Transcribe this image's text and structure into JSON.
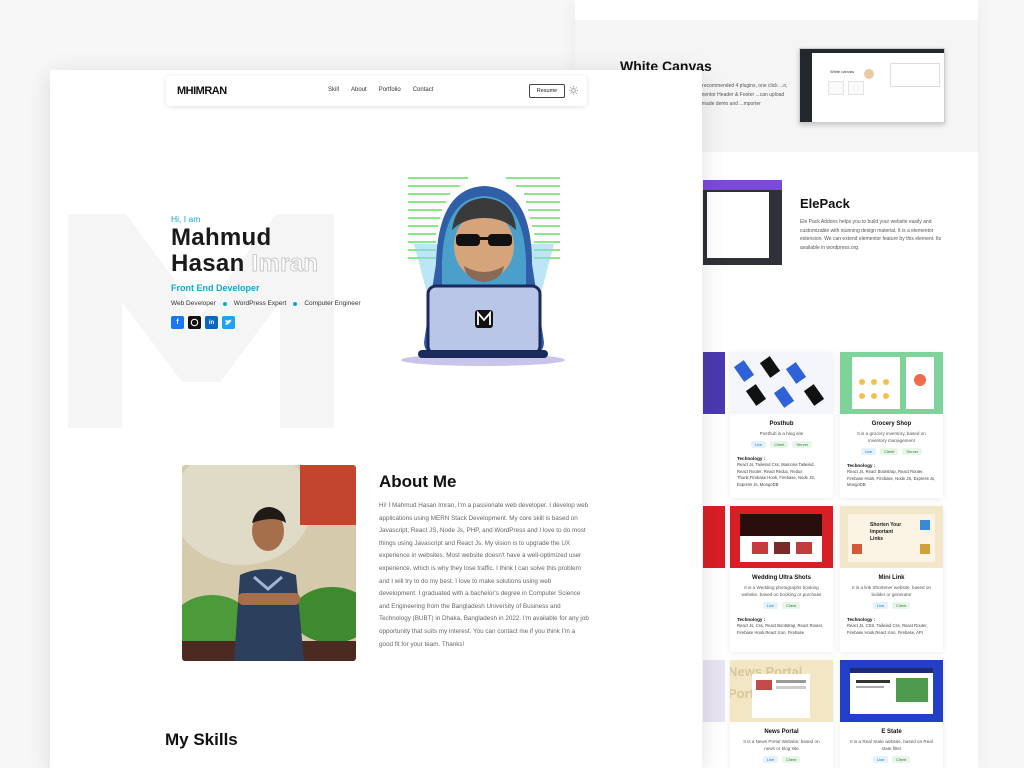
{
  "nav": {
    "logo": "MHIMRAN",
    "links": [
      "Skill",
      "About",
      "Portfolio",
      "Contact"
    ],
    "resume_label": "Resume"
  },
  "hero": {
    "greeting": "Hi, I am",
    "name_line1": "Mahmud",
    "name_line2_a": "Hasan",
    "name_line2_b": "Imran",
    "role": "Front End Developer",
    "tags": [
      "Web Developer",
      "WordPress Expert",
      "Computer Engineer"
    ],
    "socials": [
      {
        "label": "f",
        "color": "#1877f2",
        "icon": "facebook-icon"
      },
      {
        "label": "",
        "color": "#111111",
        "icon": "github-icon"
      },
      {
        "label": "in",
        "color": "#0a66c2",
        "icon": "linkedin-icon"
      },
      {
        "label": "",
        "color": "#1da1f2",
        "icon": "twitter-icon"
      }
    ]
  },
  "about": {
    "title": "About Me",
    "text": "Hi! I Mahmud Hasan Imran, I'm a passionate web developer. I develop web applications using MERN Stack Development. My core skill is based on Javascript, React JS, Node Js, PHP, and WordPress and I love to do most things using Javascript and React Js. My vision is to upgrade the UX experience in websites. Most website doesn't have a well-optimized user experience, which is why they lose traffic. I think I can solve this problem and I will try to do my best. I love to make solutions using web development. I graduated with a bachelor's degree in Computer Science and Engineering from the Bangladesh University of Business and Technology (BUBT) in Dhaka, Bangladesh in 2022. I'm available for any job opportunity that suits my interest. You can contact me if you think I'm a good fit for your team. Thanks!"
  },
  "skills": {
    "title": "My Skills"
  },
  "back": {
    "white_canvas": {
      "title": "White Canvas",
      "desc": "...is recommended 4 plugins, one click ...n, Elementor Header & Footer ...can upload pre-made demo and ...mporter"
    },
    "elepack": {
      "title": "ElePack",
      "desc": "Ele Pack Addons helps you to build your website easily and customizable with stunning design material. It is a elementor extension. We can extend elementor feature by this element. Its available in wordpress.org."
    },
    "projects": [
      {
        "name": "Posthub",
        "desc": "Posthub is a blog site",
        "buttons": [
          "Live",
          "Client",
          "Server"
        ],
        "tech_title": "Technology :",
        "tech": "React Js, Tailwind Css, Mamoria Tailwind, React Router, React Redux, Redux Thunk,Firebase Hook, Firebase, Node JS, Express Js, MongoDB"
      },
      {
        "name": "Grocery Shop",
        "desc": "It is a grocery inventory, based on inventory management",
        "buttons": [
          "Live",
          "Client",
          "Server"
        ],
        "tech_title": "Technology :",
        "tech": "React Js, React Bootstrap, React Router, Firebase Hook, Firebase, Node JS, Express Js, MongoDB"
      },
      {
        "name": "Wedding Ultra Shots",
        "desc": "It is a Wedding photographs booking website, based on booking or purchase",
        "buttons": [
          "Live",
          "Client"
        ],
        "tech_title": "Technology :",
        "tech": "React Js, Css, React Bootstrap, React Router, Firebase Hook,React Icon, Firebase"
      },
      {
        "name": "Mini Link",
        "desc": "It is a link Shortener website, based on builder or generator",
        "buttons": [
          "Live",
          "Client"
        ],
        "tech_title": "Technology :",
        "tech": "React Js, CSS, Tailwind Css, React Router, Firebase Hook,React Icon, Firebase, API"
      },
      {
        "name": "News Portal",
        "desc": "It is a News Portal Website, based on news or blog site",
        "buttons": [
          "Live",
          "Client"
        ]
      },
      {
        "name": "E State",
        "desc": "It is a Real State website, based on Real state filter",
        "buttons": [
          "Live",
          "Client"
        ]
      }
    ]
  },
  "colors": {
    "accent": "#12a6d6",
    "laptop": "#b9c6e8",
    "hood": "#4aa3c9"
  }
}
